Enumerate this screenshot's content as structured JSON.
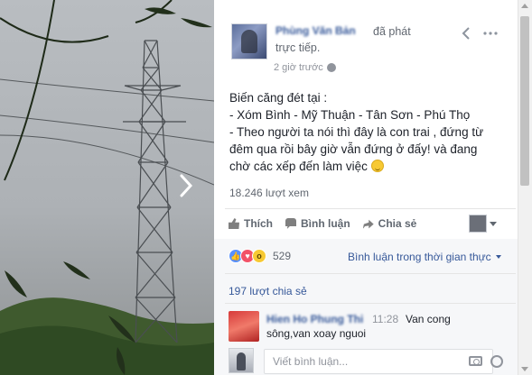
{
  "post": {
    "author": "Phùng Văn Bản",
    "action_line1": "đã phát",
    "action_line2": "trực tiếp.",
    "time": "2 giờ trước",
    "text_lines": [
      "Biến căng đét tại :",
      "- Xóm Bình - Mỹ Thuận - Tân Sơn - Phú Thọ",
      "- Theo người ta nói thì đây là con trai , đứng từ",
      "đêm qua rồi bây giờ vẫn đứng ở đấy! và đang",
      "chờ các xếp đến làm việc"
    ],
    "views": "18.246 lượt xem"
  },
  "icons": {
    "back": "chevron-left-icon",
    "options": "more-dots-icon",
    "next": "chevron-right-icon",
    "smiley": "smiley-emoji-icon",
    "globe": "globe-icon"
  },
  "actions": {
    "like": "Thích",
    "comment": "Bình luận",
    "share": "Chia sẻ"
  },
  "reactions": {
    "count": "529",
    "realtime_link": "Bình luận trong thời gian thực"
  },
  "shares": "197 lượt chia sẻ",
  "comment": {
    "name": "Hien Ho Phung Thi",
    "time": "11:28",
    "text_line1": "Van cong",
    "text_line2": "sông,van xoay nguoi"
  },
  "comment_input": {
    "placeholder": "Viết bình luận..."
  },
  "colors": {
    "link": "#365899",
    "like_reaction": "#5890ff",
    "love_reaction": "#f25268",
    "wow_reaction": "#f7c933"
  }
}
